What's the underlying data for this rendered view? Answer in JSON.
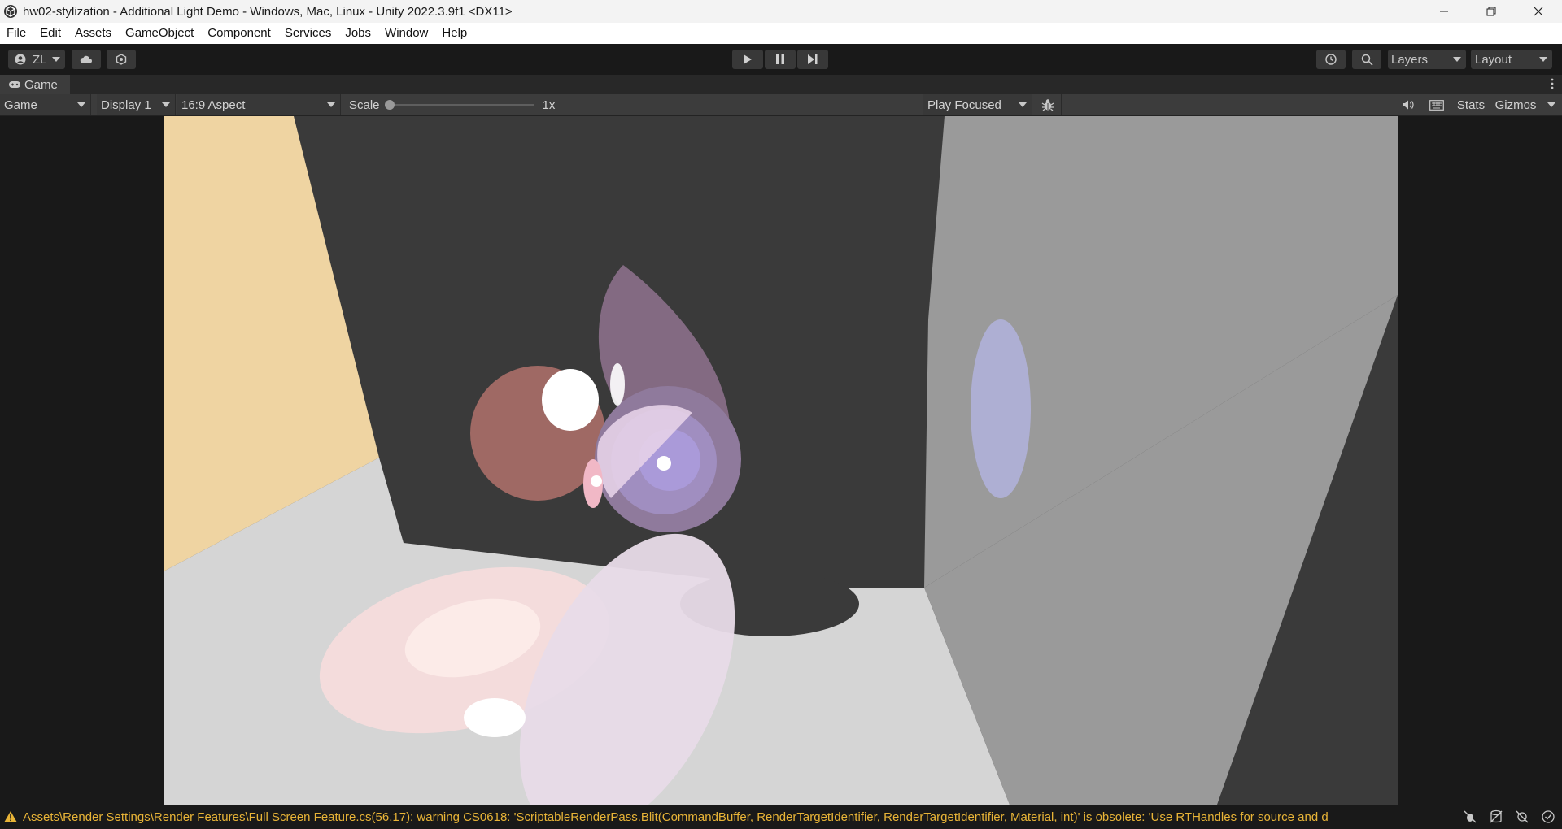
{
  "window": {
    "title": "hw02-stylization - Additional Light Demo - Windows, Mac, Linux - Unity 2022.3.9f1 <DX11>",
    "controls": [
      "minimize-icon",
      "restore-icon",
      "close-icon"
    ]
  },
  "menu": [
    "File",
    "Edit",
    "Assets",
    "GameObject",
    "Component",
    "Services",
    "Jobs",
    "Window",
    "Help"
  ],
  "toolbar": {
    "account_label": "ZL",
    "layers_label": "Layers",
    "layout_label": "Layout",
    "icons": [
      "cloud-icon",
      "collab-icon",
      "play-icon",
      "pause-icon",
      "step-icon",
      "history-icon",
      "search-icon"
    ]
  },
  "tab": {
    "label": "Game"
  },
  "gamebar": {
    "view_mode": "Game",
    "display": "Display 1",
    "aspect": "16:9 Aspect",
    "scale_label": "Scale",
    "scale_value": "1x",
    "scale_level": 0,
    "play_mode": "Play Focused",
    "stats_label": "Stats",
    "gizmos_label": "Gizmos"
  },
  "status": {
    "message": "Assets\\Render Settings\\Render Features\\Full Screen Feature.cs(56,17): warning CS0618: 'ScriptableRenderPass.Blit(CommandBuffer, RenderTargetIdentifier, RenderTargetIdentifier, Material, int)' is obsolete: 'Use RTHandles for source and d"
  },
  "colors": {
    "accent_warning": "#e8b437",
    "editor_bg": "#191919",
    "panel_bg": "#3c3c3c"
  }
}
